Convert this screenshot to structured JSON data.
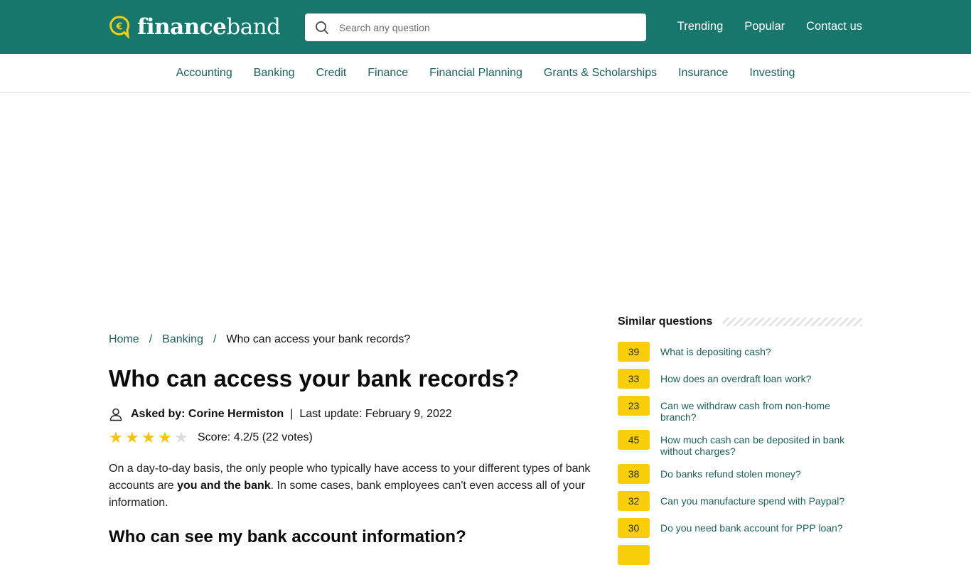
{
  "header": {
    "logo": {
      "bold": "finance",
      "light": "band",
      "icon": "euro-speech-bubble-icon"
    },
    "search": {
      "placeholder": "Search any question",
      "value": ""
    },
    "links": [
      "Trending",
      "Popular",
      "Contact us"
    ],
    "colors": {
      "brand": "#17776c",
      "accent": "#f9cf0b"
    }
  },
  "categories": [
    "Accounting",
    "Banking",
    "Credit",
    "Finance",
    "Financial Planning",
    "Grants & Scholarships",
    "Insurance",
    "Investing"
  ],
  "breadcrumb": {
    "home": "Home",
    "category": "Banking",
    "current": "Who can access your bank records?",
    "separator": "/"
  },
  "article": {
    "title": "Who can access your bank records?",
    "asked_by": "Asked by: Corine Hermiston",
    "pipe": "|",
    "last_update": "Last update: February 9, 2022",
    "rating": {
      "value": 4.2,
      "max": 5,
      "filled_stars": 4,
      "score_text": "Score: 4.2/5 (22 votes)"
    },
    "paragraph": {
      "before": "On a day-to-day basis, the only people who typically have access to your different types of bank accounts are ",
      "bold": "you and the bank",
      "after": ". In some cases, bank employees can't even access all of your information."
    },
    "subheading": "Who can see my bank account information?"
  },
  "similar": {
    "heading": "Similar questions",
    "items": [
      {
        "count": "39",
        "text": "What is depositing cash?"
      },
      {
        "count": "33",
        "text": "How does an overdraft loan work?"
      },
      {
        "count": "23",
        "text": "Can we withdraw cash from non-home branch?"
      },
      {
        "count": "45",
        "text": "How much cash can be deposited in bank without charges?"
      },
      {
        "count": "38",
        "text": "Do banks refund stolen money?"
      },
      {
        "count": "32",
        "text": "Can you manufacture spend with Paypal?"
      },
      {
        "count": "30",
        "text": "Do you need bank account for PPP loan?"
      }
    ]
  }
}
